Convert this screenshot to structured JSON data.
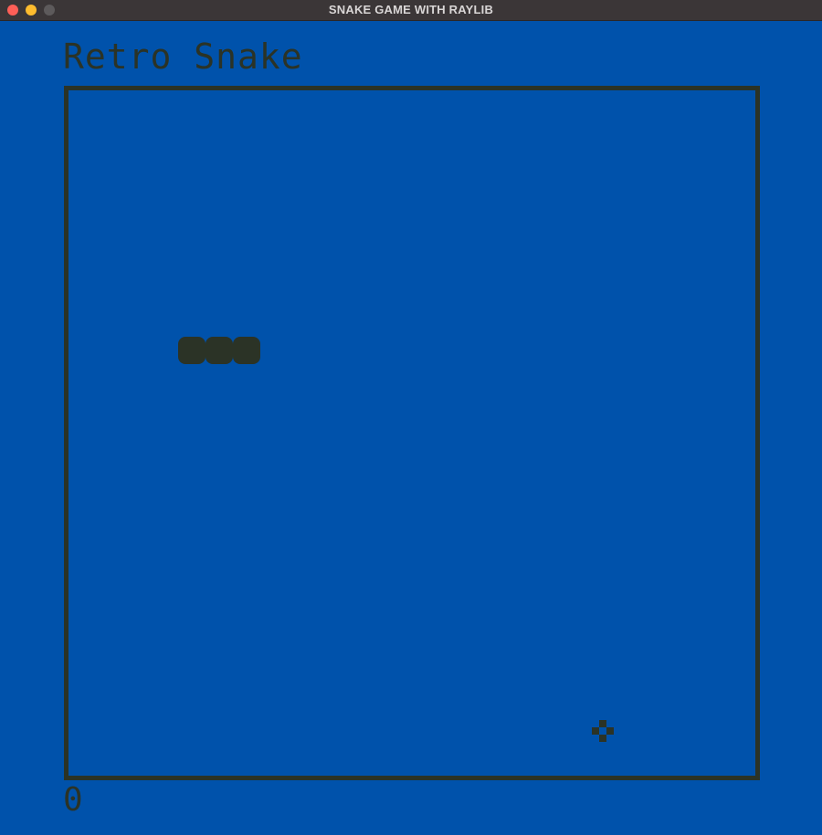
{
  "window": {
    "title": "SNAKE GAME WITH RAYLIB",
    "background_color": "#0052ab",
    "foreground_color": "#2b3326"
  },
  "game": {
    "title": "Retro Snake",
    "score": "0",
    "snake_segments": 3,
    "food_icon": "food-icon"
  }
}
